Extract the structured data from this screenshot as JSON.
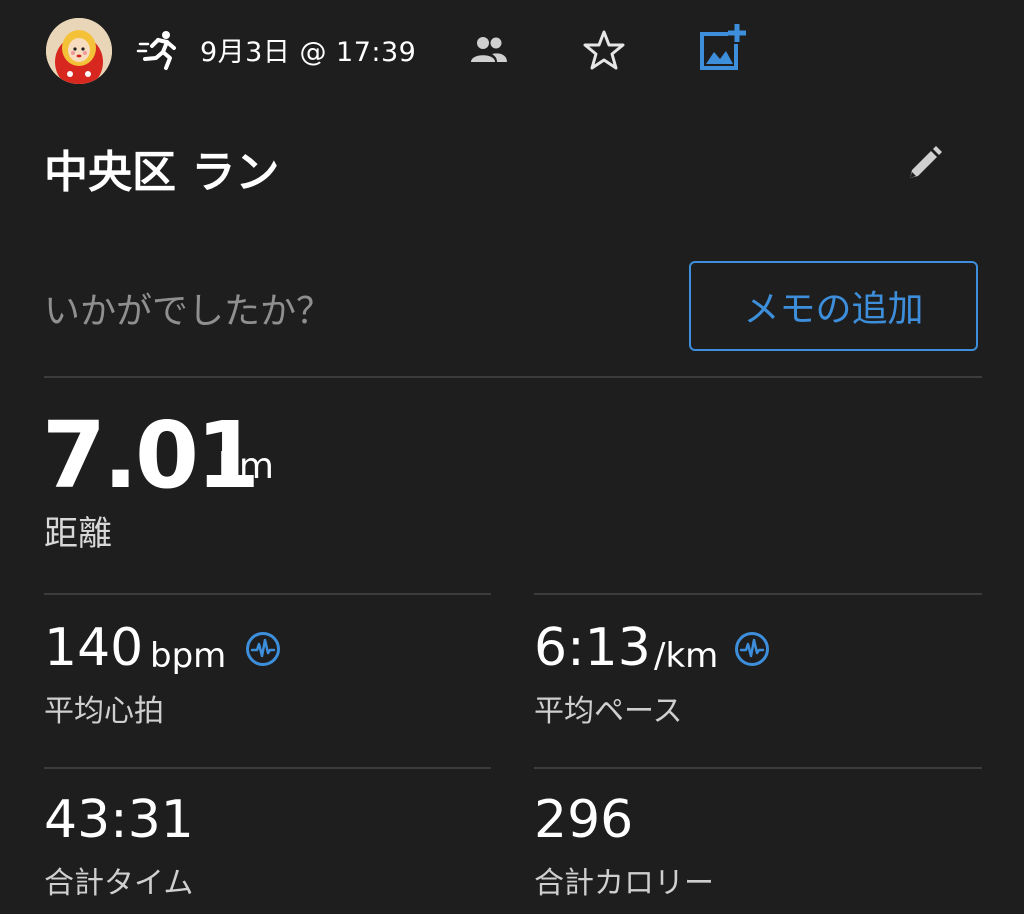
{
  "header": {
    "avatar_icon": "matryoshka-avatar",
    "activity_icon": "running-icon",
    "datetime": "9月3日 @ 17:39",
    "icons": [
      "people-icon",
      "star-icon",
      "add-photo-icon"
    ]
  },
  "activity": {
    "title": "中央区 ラン",
    "edit_icon": "pencil-icon"
  },
  "notes": {
    "prompt": "いかがでしたか？",
    "add_memo_label": "メモの追加"
  },
  "distance": {
    "value": "7.01",
    "unit": "km",
    "label": "距離"
  },
  "stats": [
    {
      "value": "140",
      "unit": "bpm",
      "label": "平均心拍",
      "icon": "pulse-icon"
    },
    {
      "value": "6:13",
      "unit": "/km",
      "label": "平均ペース",
      "icon": "pulse-icon"
    },
    {
      "value": "43:31",
      "unit": "",
      "label": "合計タイム"
    },
    {
      "value": "296",
      "unit": "",
      "label": "合計カロリー"
    }
  ],
  "colors": {
    "background": "#1e1e1e",
    "accent": "#3d8fdc",
    "muted_text": "#8f8f8f",
    "divider": "#3c3c3c"
  }
}
